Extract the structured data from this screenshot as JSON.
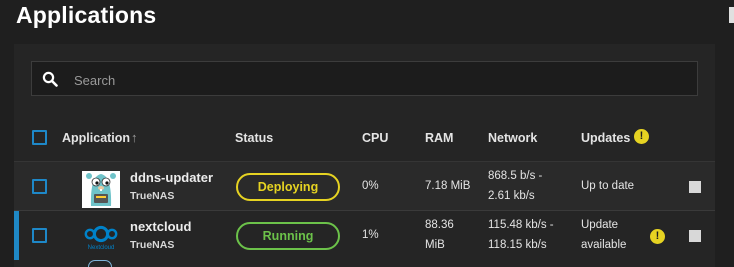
{
  "header": {
    "title": "Applications"
  },
  "search": {
    "placeholder": "Search",
    "icon": "search-icon"
  },
  "table": {
    "columns": {
      "application": "Application",
      "status": "Status",
      "cpu": "CPU",
      "ram": "RAM",
      "network": "Network",
      "updates": "Updates"
    },
    "sort_icon": "arrow-up-icon",
    "updates_header_icon": "warning-icon",
    "rows": [
      {
        "name": "ddns-updater",
        "train": "TrueNAS",
        "logo_icon": "gopher-logo",
        "status": "Deploying",
        "status_color": "#e6d322",
        "cpu": "0%",
        "ram": "7.18 MiB",
        "network_line1": "868.5 b/s -",
        "network_line2": "2.61 kb/s",
        "updates": "Up to date",
        "update_flag": false
      },
      {
        "name": "nextcloud",
        "train": "TrueNAS",
        "logo_icon": "nextcloud-logo",
        "logo_text": "Nextcloud",
        "status": "Running",
        "status_color": "#6cc24a",
        "cpu": "1%",
        "ram_line1": "88.36",
        "ram_line2": "MiB",
        "network_line1": "115.48 kb/s -",
        "network_line2": "118.15 kb/s",
        "updates_line1": "Update",
        "updates_line2": "available",
        "update_flag": true,
        "selected": true
      }
    ]
  },
  "colors": {
    "accent": "#1f88c5",
    "warning": "#e6d322",
    "running": "#6cc24a",
    "background": "#1f1f1f",
    "panel": "#252525"
  }
}
